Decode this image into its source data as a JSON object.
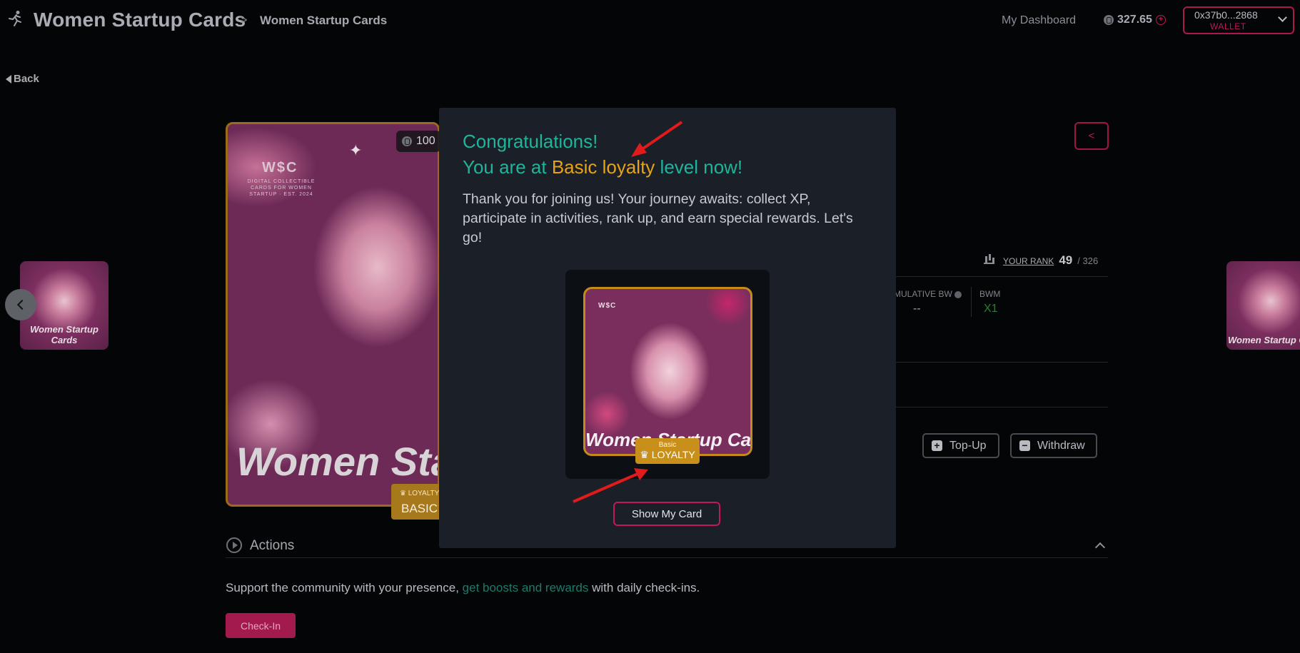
{
  "header": {
    "app_title": "Women Startup Cards",
    "breadcrumb_separator": ">",
    "breadcrumb_current": "Women Startup Cards",
    "dashboard_link": "My Dashboard",
    "balance": "327.65",
    "wallet_address": "0x37b0...2868",
    "wallet_label": "WALLET"
  },
  "back_label": "Back",
  "thumbnails": {
    "left_caption": "Women Startup Cards",
    "right_caption": "Women Startup Ca"
  },
  "main_card": {
    "logo": "W$C",
    "subtitle": "DIGITAL COLLECTIBLE CARDS FOR WOMEN STARTUP · EST. 2024",
    "title": "Women Startu",
    "xp_value": "100",
    "loyalty_small": "LOYALTY",
    "loyalty_level": "BASIC"
  },
  "stats": {
    "rank_label": "YOUR RANK",
    "rank_value": "49",
    "rank_total": "/ 326",
    "cumulative_bw_label": "MULATIVE BW",
    "cumulative_bw_value": "--",
    "bwm_label": "BWM",
    "bwm_value": "X1"
  },
  "buttons": {
    "topup": "Top-Up",
    "withdraw": "Withdraw",
    "share": "<"
  },
  "actions": {
    "title": "Actions",
    "support_prefix": "Support the community with your presence, ",
    "support_link": "get boosts and rewards",
    "support_suffix": " with daily check-ins.",
    "checkin": "Check-In"
  },
  "modal": {
    "heading_line1": "Congratulations!",
    "heading_prefix": "You are at ",
    "heading_highlight": "Basic loyalty",
    "heading_suffix": " level now!",
    "body": "Thank you for joining us! Your journey awaits: collect XP, participate in activities, rank up, and earn special rewards. Let's go!",
    "card_logo": "W$C",
    "card_title": "Women Startup Cards",
    "badge_small": "Basic",
    "badge_big": "LOYALTY",
    "show_card_button": "Show My Card"
  },
  "colors": {
    "accent_pink": "#c2185b",
    "teal": "#1eb59c",
    "gold": "#e6a317",
    "annotation_arrow": "#e01b1b"
  }
}
